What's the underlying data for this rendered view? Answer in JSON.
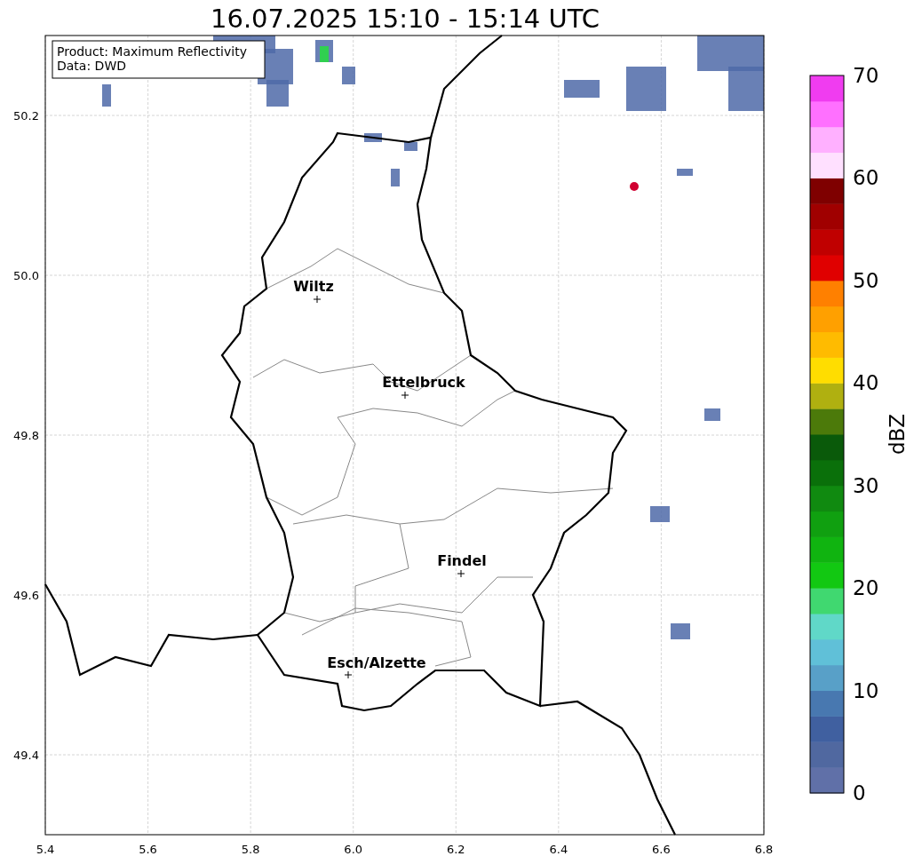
{
  "title": "16.07.2025 15:10 - 15:14 UTC",
  "info_box": [
    "Product: Maximum Reflectivity",
    "Data: DWD"
  ],
  "x_ticks": [
    "5.4",
    "5.6",
    "5.8",
    "6.0",
    "6.2",
    "6.4",
    "6.6",
    "6.8"
  ],
  "y_ticks": [
    "50.2",
    "50.0",
    "49.8",
    "49.6",
    "49.4"
  ],
  "places": [
    {
      "name": "Wiltz"
    },
    {
      "name": "Ettelbruck"
    },
    {
      "name": "Findel"
    },
    {
      "name": "Esch/Alzette"
    }
  ],
  "colorbar": {
    "label": "dBZ",
    "ticks": [
      "70",
      "60",
      "50",
      "40",
      "30",
      "20",
      "10",
      "0"
    ],
    "bins": [
      {
        "color": "#6070a8"
      },
      {
        "color": "#5068a0"
      },
      {
        "color": "#4060a0"
      },
      {
        "color": "#4878b0"
      },
      {
        "color": "#58a0c8"
      },
      {
        "color": "#60c0d8"
      },
      {
        "color": "#60d8c8"
      },
      {
        "color": "#40d870"
      },
      {
        "color": "#12c812"
      },
      {
        "color": "#10b410"
      },
      {
        "color": "#10a010"
      },
      {
        "color": "#108a10"
      },
      {
        "color": "#0a700a"
      },
      {
        "color": "#0a5a0a"
      },
      {
        "color": "#4c7a0a"
      },
      {
        "color": "#b0b010"
      },
      {
        "color": "#ffdd00"
      },
      {
        "color": "#ffbb00"
      },
      {
        "color": "#ffa000"
      },
      {
        "color": "#ff8000"
      },
      {
        "color": "#e00000"
      },
      {
        "color": "#c00000"
      },
      {
        "color": "#a00000"
      },
      {
        "color": "#7f0000"
      },
      {
        "color": "#ffe0ff"
      },
      {
        "color": "#ffb0ff"
      },
      {
        "color": "#ff70ff"
      },
      {
        "color": "#f03cf0"
      }
    ]
  }
}
